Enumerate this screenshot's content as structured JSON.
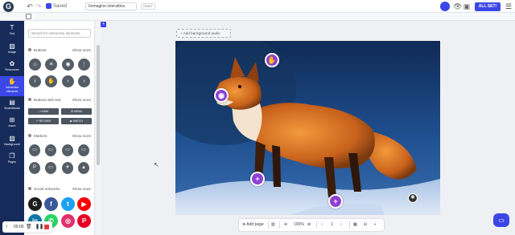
{
  "topbar": {
    "logo": "G",
    "undo_icon": "↶",
    "redo_icon": "↷",
    "saved_label": "Saved",
    "title_value": "Immagine interattiva",
    "draft_tag": "DRAFT",
    "preview_icon": "👁",
    "save_icon": "▣",
    "all_set_label": "ALL SET!",
    "menu_icon": "☰"
  },
  "leftnav": {
    "items": [
      {
        "icon": "T",
        "label": "Text"
      },
      {
        "icon": "▨",
        "label": "Image"
      },
      {
        "icon": "✿",
        "label": "Resources"
      },
      {
        "icon": "✋",
        "label": "Interactive elements"
      },
      {
        "icon": "▤",
        "label": "Smartblocks"
      },
      {
        "icon": "⊞",
        "label": "Insert"
      },
      {
        "icon": "▧",
        "label": "Background"
      },
      {
        "icon": "❐",
        "label": "Pages"
      }
    ]
  },
  "panel": {
    "search_placeholder": "Search for interactive elements",
    "sections": {
      "buttons": {
        "title": "Buttons",
        "show_more": "Show more"
      },
      "buttons_with_text": {
        "title": "Buttons with text",
        "show_more": "Show more"
      },
      "markers": {
        "title": "Markers",
        "show_more": "Show more"
      },
      "social": {
        "title": "Social networks",
        "show_more": "Show more"
      }
    },
    "button_icons": [
      "⌂",
      "≡",
      "◉",
      "⋮",
      "i",
      "✋",
      "‹",
      "›"
    ],
    "text_buttons": [
      "⌂ HOME",
      "☰ MENU",
      "↶ RETURN",
      "▶ WATCH"
    ],
    "marker_icons": [
      "▭",
      "▭",
      "▭",
      "▭",
      "P",
      "▭",
      "✈",
      "▲"
    ],
    "social": [
      {
        "icon": "G",
        "color": "#1c1c1c"
      },
      {
        "icon": "f",
        "color": "#3b5998"
      },
      {
        "icon": "t",
        "color": "#1da1f2"
      },
      {
        "icon": "▶",
        "color": "#ff0000"
      },
      {
        "icon": "in",
        "color": "#0e76a8"
      },
      {
        "icon": "✆",
        "color": "#25d366"
      },
      {
        "icon": "◎",
        "color": "#e1306c"
      },
      {
        "icon": "P",
        "color": "#e60023"
      }
    ]
  },
  "recorder": {
    "back_icon": "‹",
    "time": "00:00",
    "trash_icon": "🗑",
    "pause_icon": "❚❚"
  },
  "canvas": {
    "page_badge": "+",
    "bg_audio_label": "+ Add background audio",
    "hotspots": [
      {
        "icon": "✋"
      },
      {
        "icon": "◉"
      },
      {
        "icon": "+"
      },
      {
        "icon": "+"
      }
    ],
    "small_hotspot_icon": "◉"
  },
  "bottombar": {
    "add_page": "⊕ Add page",
    "zoom_out": "⊖",
    "zoom_value": "100%",
    "zoom_in": "⊕",
    "prev": "‹",
    "page_num": "1",
    "next": "›",
    "grid_icon": "▦",
    "layout_icon": "⊟",
    "settings_icon": "◐"
  },
  "colors": {
    "accent": "#3b47e6",
    "nav_bg": "#172b5a",
    "hotspot": "#8e3fd3"
  }
}
